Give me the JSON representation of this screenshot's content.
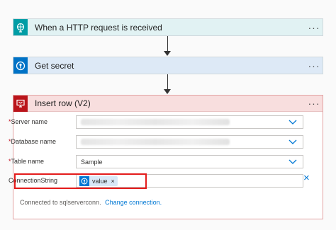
{
  "steps": [
    {
      "title": "When a HTTP request is received",
      "icon": "http-request-icon",
      "bar_color": "#009da5",
      "bg": "#e1f2f3",
      "more": "···"
    },
    {
      "title": "Get secret",
      "icon": "key-vault-icon",
      "bar_color": "#0072c6",
      "bg": "#dde9f6",
      "more": "···"
    }
  ],
  "insert": {
    "title": "Insert row (V2)",
    "icon": "sql-server-icon",
    "bar_color": "#ba141a",
    "more": "···",
    "fields": {
      "server": {
        "label": "Server name",
        "required": "*"
      },
      "database": {
        "label": "Database name",
        "required": "*"
      },
      "table": {
        "label": "Table name",
        "required": "*",
        "value": "Sample"
      },
      "connection": {
        "label": "ConnectionString",
        "token": "value",
        "token_remove": "×"
      }
    },
    "remove_field": "×",
    "footer": {
      "text": "Connected to sqlserverconn.",
      "link": "Change connection."
    }
  },
  "colors": {
    "highlight": "#e41b1b",
    "link": "#0078d4"
  }
}
